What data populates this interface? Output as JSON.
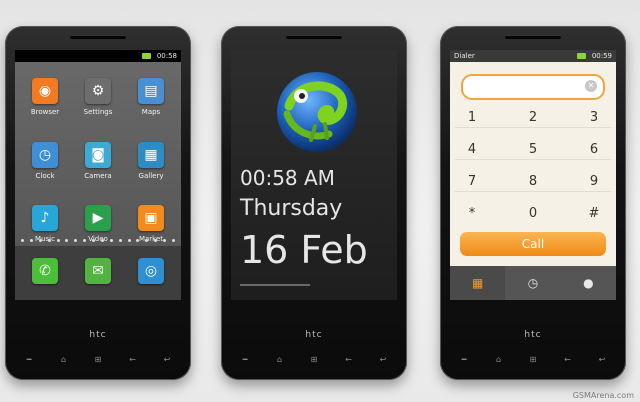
{
  "phone_left": {
    "status_time": "00:58",
    "apps": [
      {
        "label": "Browser",
        "icon": "firefox-icon",
        "color": "#f17a22"
      },
      {
        "label": "Settings",
        "icon": "gear-icon",
        "color": "#6d6d6d"
      },
      {
        "label": "Maps",
        "icon": "map-icon",
        "color": "#4a8fd1"
      },
      {
        "label": "Clock",
        "icon": "clock-icon",
        "color": "#3f8fd7"
      },
      {
        "label": "Camera",
        "icon": "camera-icon",
        "color": "#3fa9d6"
      },
      {
        "label": "Gallery",
        "icon": "gallery-icon",
        "color": "#2e8cc4"
      },
      {
        "label": "Music",
        "icon": "music-icon",
        "color": "#27a7d8"
      },
      {
        "label": "Video",
        "icon": "video-icon",
        "color": "#2aa04a"
      },
      {
        "label": "Market",
        "icon": "market-icon",
        "color": "#f28a1e"
      }
    ],
    "dock": [
      {
        "icon": "phone-icon",
        "color": "#4bbf3a"
      },
      {
        "icon": "messages-icon",
        "color": "#52b340"
      },
      {
        "icon": "browser-globe-icon",
        "color": "#2f8fd0"
      }
    ]
  },
  "phone_middle": {
    "time": "00:58 AM",
    "day": "Thursday",
    "date": "16 Feb"
  },
  "phone_right": {
    "title": "Dialer",
    "status_time": "00:59",
    "keys": [
      "1",
      "2",
      "3",
      "4",
      "5",
      "6",
      "7",
      "8",
      "9",
      "*",
      "0",
      "#"
    ],
    "call_label": "Call",
    "tabs": [
      "dialpad-icon",
      "history-icon",
      "contacts-icon"
    ]
  },
  "device": {
    "brand": "htc"
  },
  "watermark": "GSMArena.com"
}
